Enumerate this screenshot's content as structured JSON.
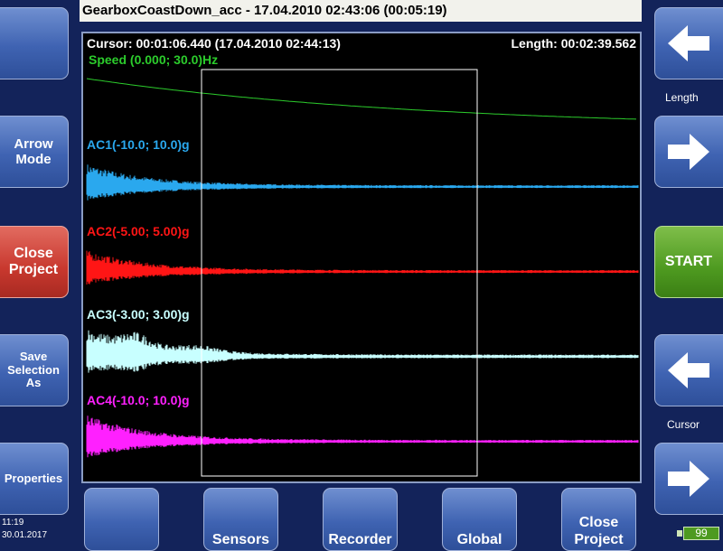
{
  "title": "GearboxCoastDown_acc - 17.04.2010 02:43:06 (00:05:19)",
  "cursor_text": "Cursor: 00:01:06.440 (17.04.2010 02:44:13)",
  "length_text": "Length: 00:02:39.562",
  "colors": {
    "speed": "#2ccc2c",
    "ac1": "#2aa8ee",
    "ac2": "#ff1515",
    "ac3": "#c8ffff",
    "ac4": "#ff20ff",
    "cursor_line": "#ffffff"
  },
  "traces": {
    "speed": {
      "label": "Speed (0.000; 30.0)Hz"
    },
    "ac1": {
      "label": "AC1(-10.0; 10.0)g"
    },
    "ac2": {
      "label": "AC2(-5.00; 5.00)g"
    },
    "ac3": {
      "label": "AC3(-3.00; 3.00)g"
    },
    "ac4": {
      "label": "AC4(-10.0; 10.0)g"
    }
  },
  "left_buttons": {
    "blank": "",
    "arrow_mode": "Arrow Mode",
    "close_project": "Close Project",
    "save_selection_as": "Save Selection As",
    "properties": "Properties"
  },
  "right_panel": {
    "length_label": "Length",
    "start": "START",
    "cursor_label": "Cursor"
  },
  "bottom_buttons": {
    "blank": "",
    "sensors": "Sensors",
    "recorder": "Recorder",
    "global": "Global",
    "close_project": "Close Project"
  },
  "status": {
    "time": "11:19",
    "date": "30.01.2017",
    "battery": "99"
  },
  "icons": {
    "length_left": "arrow-left-icon",
    "length_right": "arrow-right-icon",
    "cursor_left": "arrow-left-icon",
    "cursor_right": "arrow-right-icon",
    "battery": "battery-icon"
  }
}
